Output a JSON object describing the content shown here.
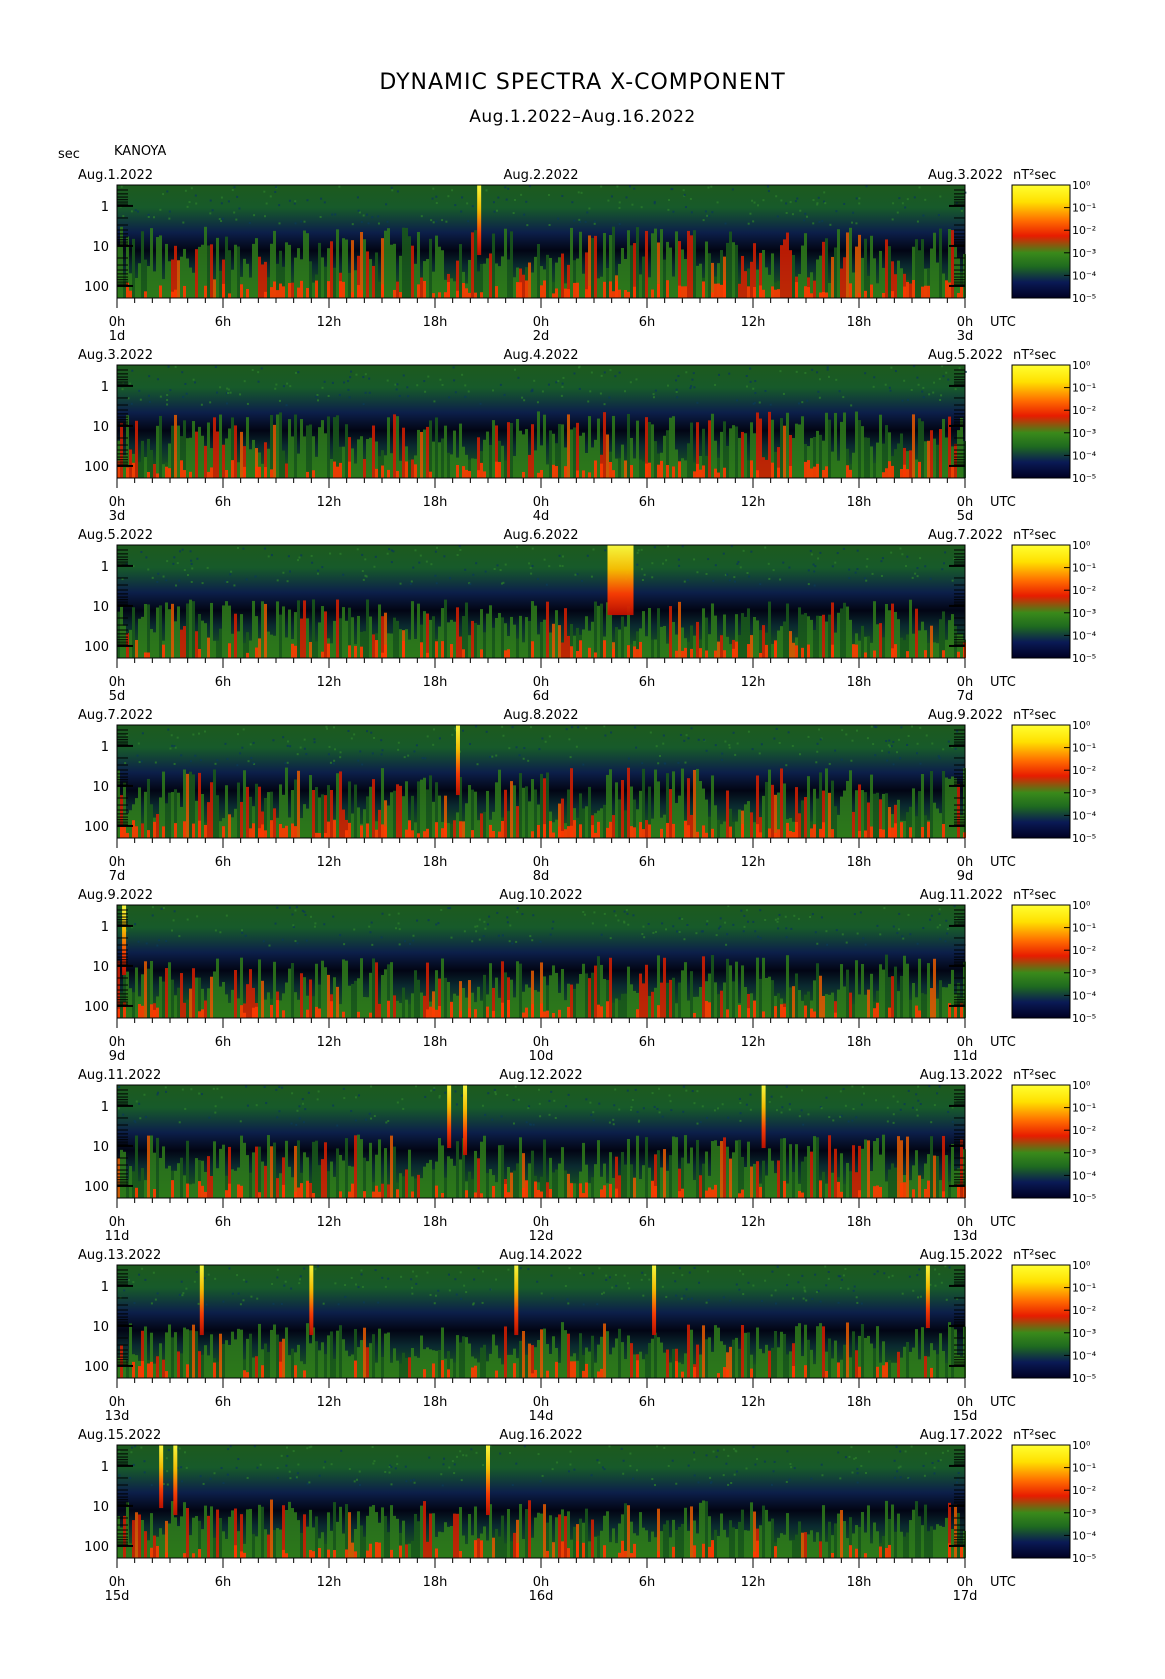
{
  "header": {
    "title": "DYNAMIC SPECTRA X-COMPONENT",
    "subtitle": "Aug.1.2022–Aug.16.2022",
    "y_unit": "sec",
    "station": "KANOYA"
  },
  "colors": {
    "scale": [
      "#000022",
      "#0a1a55",
      "#1f6b1f",
      "#3a8a1a",
      "#e81c00",
      "#ff6a00",
      "#ffe000",
      "#ffff30"
    ]
  },
  "chart_data": {
    "type": "heatmap",
    "title": "DYNAMIC SPECTRA X-COMPONENT",
    "subtitle": "Aug.1.2022–Aug.16.2022",
    "ylabel": "sec",
    "y_scale": "log",
    "y_ticks": [
      "1",
      "10",
      "100"
    ],
    "y_range_sec": [
      0.3,
      200
    ],
    "x_tick_labels": [
      "0h",
      "6h",
      "12h",
      "18h",
      "0h",
      "6h",
      "12h",
      "18h",
      "0h"
    ],
    "x_unit": "UTC",
    "colorbar": {
      "unit": "nT²sec",
      "labels": [
        "10⁰",
        "10⁻¹",
        "10⁻²",
        "10⁻³",
        "10⁻⁴",
        "10⁻⁵"
      ],
      "range_log10": [
        -5,
        0
      ]
    },
    "panels": [
      {
        "left_date": "Aug.1.2022",
        "mid_date": "Aug.2.2022",
        "right_date": "Aug.3.2022",
        "day_labels": [
          "1d",
          "2d",
          "3d"
        ],
        "activity": 0.72,
        "spikes": [
          {
            "hour": 20.5,
            "strength": 1.0
          }
        ]
      },
      {
        "left_date": "Aug.3.2022",
        "mid_date": "Aug.4.2022",
        "right_date": "Aug.5.2022",
        "day_labels": [
          "3d",
          "4d",
          "5d"
        ],
        "activity": 0.62,
        "spikes": []
      },
      {
        "left_date": "Aug.5.2022",
        "mid_date": "Aug.6.2022",
        "right_date": "Aug.7.2022",
        "day_labels": [
          "5d",
          "6d",
          "7d"
        ],
        "activity": 0.45,
        "spikes": [
          {
            "hour": 28.5,
            "strength": 1.0,
            "wide": true
          }
        ]
      },
      {
        "left_date": "Aug.7.2022",
        "mid_date": "Aug.8.2022",
        "right_date": "Aug.9.2022",
        "day_labels": [
          "7d",
          "8d",
          "9d"
        ],
        "activity": 0.7,
        "spikes": [
          {
            "hour": 19.3,
            "strength": 1.0
          }
        ]
      },
      {
        "left_date": "Aug.9.2022",
        "mid_date": "Aug.10.2022",
        "right_date": "Aug.11.2022",
        "day_labels": [
          "9d",
          "10d",
          "11d"
        ],
        "activity": 0.55,
        "spikes": [
          {
            "hour": 0.4,
            "strength": 1.0
          }
        ]
      },
      {
        "left_date": "Aug.11.2022",
        "mid_date": "Aug.12.2022",
        "right_date": "Aug.13.2022",
        "day_labels": [
          "11d",
          "12d",
          "13d"
        ],
        "activity": 0.55,
        "spikes": [
          {
            "hour": 18.8,
            "strength": 0.9
          },
          {
            "hour": 19.7,
            "strength": 1.0
          },
          {
            "hour": 36.6,
            "strength": 0.9
          }
        ]
      },
      {
        "left_date": "Aug.13.2022",
        "mid_date": "Aug.14.2022",
        "right_date": "Aug.15.2022",
        "day_labels": [
          "13d",
          "14d",
          "15d"
        ],
        "activity": 0.4,
        "spikes": [
          {
            "hour": 4.8,
            "strength": 1.0
          },
          {
            "hour": 11.0,
            "strength": 1.0
          },
          {
            "hour": 22.6,
            "strength": 1.0
          },
          {
            "hour": 30.4,
            "strength": 1.0
          },
          {
            "hour": 45.9,
            "strength": 0.9
          }
        ]
      },
      {
        "left_date": "Aug.15.2022",
        "mid_date": "Aug.16.2022",
        "right_date": "Aug.17.2022",
        "day_labels": [
          "15d",
          "16d",
          "17d"
        ],
        "activity": 0.45,
        "spikes": [
          {
            "hour": 2.5,
            "strength": 0.9
          },
          {
            "hour": 3.3,
            "strength": 1.0
          },
          {
            "hour": 21.0,
            "strength": 1.0
          }
        ]
      }
    ]
  }
}
